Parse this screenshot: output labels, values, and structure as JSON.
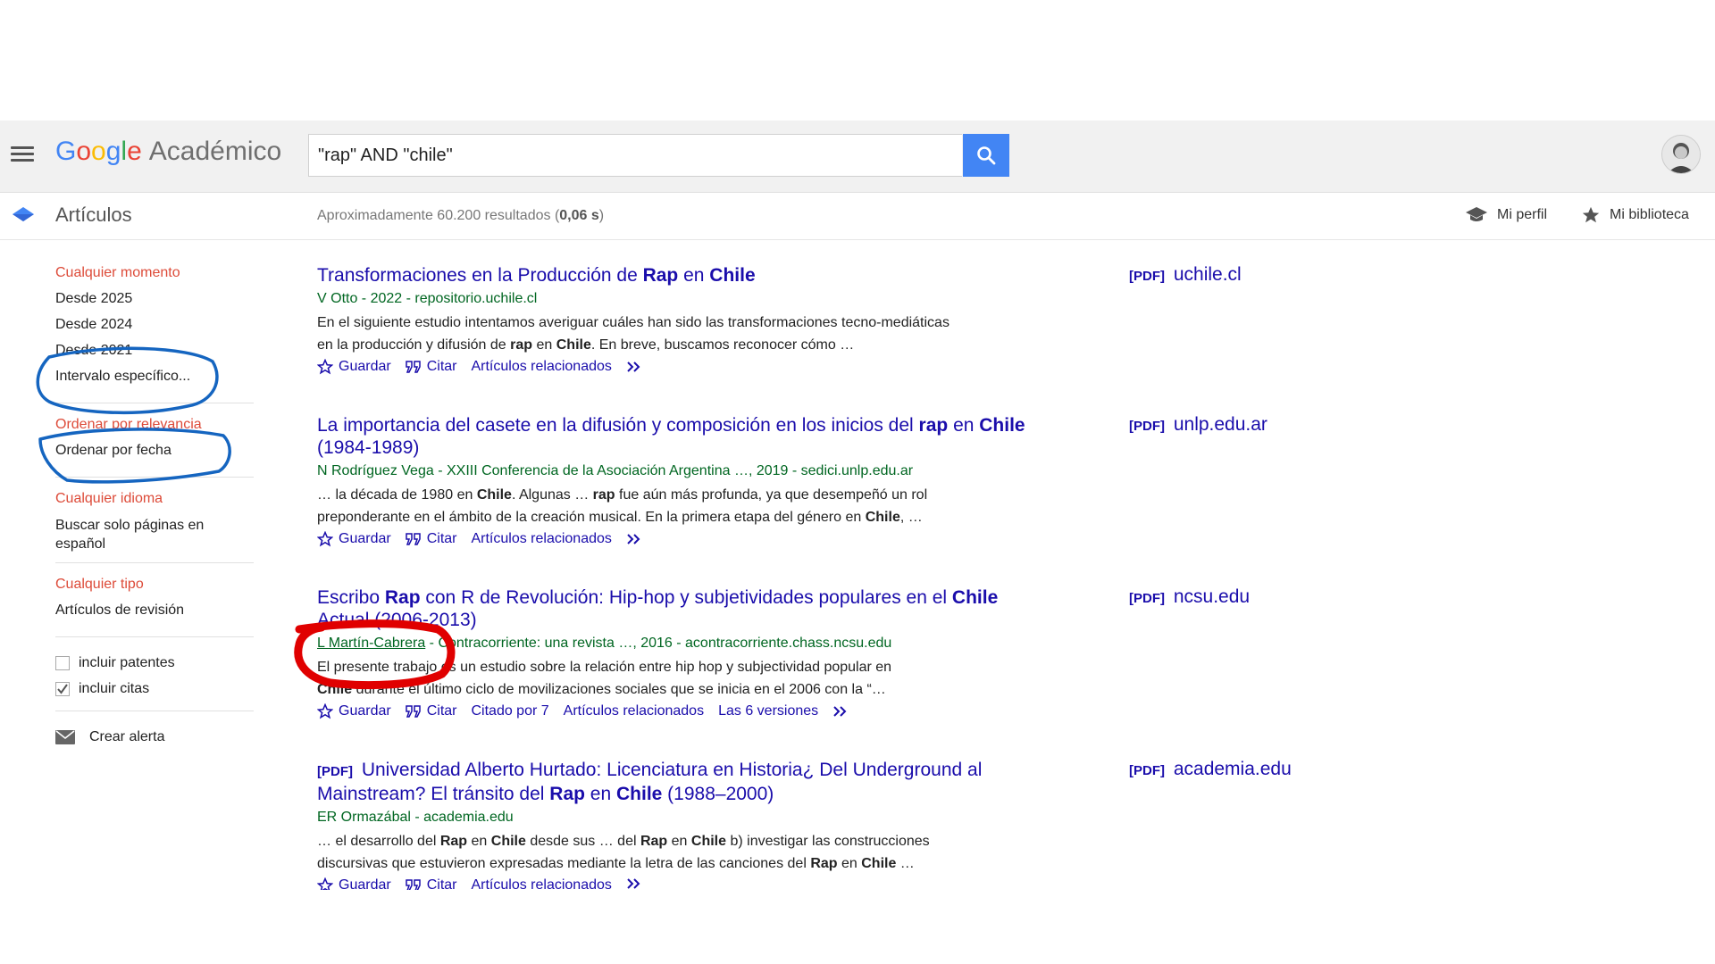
{
  "header": {
    "logo_google": "Google",
    "logo_suffix": "Académico",
    "search_value": "\"rap\" AND \"chile\""
  },
  "subbar": {
    "section": "Artículos",
    "count_prefix": "Aproximadamente 60.200 resultados (",
    "count_time": "0,06 s",
    "count_suffix": ")",
    "profile": "Mi perfil",
    "library": "Mi biblioteca"
  },
  "sidebar": {
    "time_heading": "Cualquier momento",
    "time_items": [
      "Desde 2025",
      "Desde 2024",
      "Desde 2021",
      "Intervalo específico..."
    ],
    "sort_heading": "Ordenar por relevancia",
    "sort_date": "Ordenar por fecha",
    "lang_heading": "Cualquier idioma",
    "lang_item": "Buscar solo páginas en español",
    "type_heading": "Cualquier tipo",
    "type_item": "Artículos de revisión",
    "patents": "incluir patentes",
    "citations": "incluir citas",
    "alert": "Crear alerta"
  },
  "results": [
    {
      "title_parts": [
        "Transformaciones en la Producción de ",
        "Rap",
        " en ",
        "Chile"
      ],
      "meta": "V Otto - 2022 - repositorio.uchile.cl",
      "snippet_line1": "En el siguiente estudio intentamos averiguar cuáles han sido las transformaciones tecno-mediáticas",
      "snippet_line2_parts": [
        "en la producción y difusión de ",
        "rap",
        " en ",
        "Chile",
        ". En breve, buscamos reconocer cómo …"
      ],
      "links": [
        "Guardar",
        "Citar",
        "Artículos relacionados"
      ],
      "side_tag": "[PDF]",
      "side_domain": "uchile.cl"
    },
    {
      "title_parts": [
        "La importancia del casete en la difusión y composición en los inicios del ",
        "rap",
        " en ",
        "Chile",
        " (1984-1989)"
      ],
      "meta": "N Rodríguez Vega - XXIII Conferencia de la Asociación Argentina …, 2019 - sedici.unlp.edu.ar",
      "snippet_line1_parts": [
        "… la década de 1980 en ",
        "Chile",
        ". Algunas … ",
        "rap",
        " fue aún más profunda, ya que desempeñó un rol"
      ],
      "snippet_line2_parts": [
        "preponderante en el ámbito de la creación musical. En la primera etapa del género en ",
        "Chile",
        ", …"
      ],
      "links": [
        "Guardar",
        "Citar",
        "Artículos relacionados"
      ],
      "side_tag": "[PDF]",
      "side_domain": "unlp.edu.ar"
    },
    {
      "title_parts": [
        "Escribo ",
        "Rap",
        " con R de Revolución: Hip-hop y subjetividades populares en el ",
        "Chile",
        " Actual (2006-2013)"
      ],
      "meta_author": "L Martín-Cabrera",
      "meta_rest": " - Contracorriente: una revista …, 2016 - acontracorriente.chass.ncsu.edu",
      "snippet_line1": "El presente trabajo es un estudio sobre la relación entre hip hop y subjectividad popular en",
      "snippet_line2_parts": [
        "Chile",
        " durante el último ciclo de movilizaciones sociales que se inicia en el 2006 con la “…"
      ],
      "links": [
        "Guardar",
        "Citar",
        "Citado por 7",
        "Artículos relacionados",
        "Las 6 versiones"
      ],
      "side_tag": "[PDF]",
      "side_domain": "ncsu.edu"
    },
    {
      "title_tag": "[PDF]",
      "title_parts": [
        " Universidad Alberto Hurtado: Licenciatura en Historia¿ Del Underground al Mainstream? El tránsito del ",
        "Rap",
        " en ",
        "Chile",
        " (1988–2000)"
      ],
      "meta": "ER Ormazábal - academia.edu",
      "snippet_line1_parts": [
        "… el desarrollo del ",
        "Rap",
        " en ",
        "Chile",
        " desde sus … del ",
        "Rap",
        " en ",
        "Chile",
        " b) investigar las construcciones"
      ],
      "snippet_line2_parts": [
        "discursivas que estuvieron expresadas mediante la letra de las canciones del ",
        "Rap",
        " en ",
        "Chile",
        " …"
      ],
      "links": [
        "Guardar",
        "Citar",
        "Artículos relacionados"
      ],
      "side_tag": "[PDF]",
      "side_domain": "academia.edu"
    }
  ],
  "colors": {
    "link": "#1a0dab",
    "meta_green": "#006621",
    "sidebar_red": "#dd4b39",
    "search_blue": "#4285f4",
    "annotation_blue": "#1565c0",
    "annotation_red": "#e00000"
  }
}
